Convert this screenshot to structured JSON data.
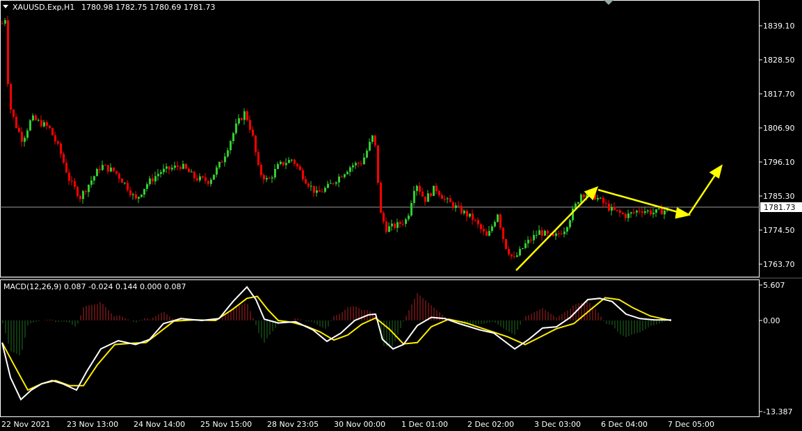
{
  "header": {
    "symbol": "XAUUSD.Exp,H1",
    "ohlc": "1780.98 1782.75 1780.69 1781.73"
  },
  "price_axis": {
    "ticks": [
      "1839.10",
      "1828.50",
      "1817.70",
      "1806.90",
      "1796.10",
      "1785.30",
      "1774.50",
      "1763.70"
    ],
    "current_price": "1781.73"
  },
  "macd_panel": {
    "label": "MACD(12,26,9) 0.087 -0.024 0.144 0.000 0.087",
    "ticks": [
      "5.607",
      "0.00",
      "-13.387"
    ]
  },
  "time_axis": {
    "labels": [
      "22 Nov 2021",
      "23 Nov 13:00",
      "24 Nov 14:00",
      "25 Nov 15:00",
      "28 Nov 23:05",
      "30 Nov 00:00",
      "1 Dec 01:00",
      "2 Dec 02:00",
      "3 Dec 03:00",
      "6 Dec 04:00",
      "7 Dec 05:00"
    ]
  },
  "colors": {
    "background": "#000000",
    "bull": "#32cd32",
    "bear": "#ff0000",
    "macd_line": "#ffffff",
    "signal_line": "#ffee00",
    "hist_pos": "#b22222",
    "hist_neg": "#1f6f1f",
    "arrow": "#ffff00",
    "grid_frame": "#ffffff"
  },
  "chart_data": {
    "type": "line",
    "price_path": {
      "x": [
        "22 Nov 2021",
        "23 Nov 13:00",
        "24 Nov 14:00",
        "25 Nov 15:00",
        "28 Nov 23:05",
        "30 Nov 00:00",
        "1 Dec 01:00",
        "2 Dec 02:00",
        "3 Dec 03:00",
        "6 Dec 04:00",
        "7 Dec 05:00"
      ],
      "close": [
        1843.5,
        1794.0,
        1788.5,
        1812.0,
        1789.0,
        1803.0,
        1788.0,
        1766.0,
        1772.5,
        1782.0,
        1781.7
      ]
    },
    "macd": {
      "x": [
        "22 Nov 2021",
        "23 Nov 13:00",
        "24 Nov 14:00",
        "25 Nov 15:00",
        "28 Nov 23:05",
        "30 Nov 00:00",
        "1 Dec 01:00",
        "2 Dec 02:00",
        "3 Dec 03:00",
        "6 Dec 04:00",
        "7 Dec 05:00"
      ],
      "series": [
        {
          "name": "MACD",
          "values": [
            -3.0,
            -7.5,
            -2.5,
            0.0,
            4.5,
            -1.5,
            0.0,
            -3.5,
            -1.0,
            3.5,
            0.087
          ]
        },
        {
          "name": "Signal",
          "values": [
            -3.5,
            -8.0,
            -3.5,
            0.0,
            3.5,
            -2.5,
            0.0,
            -3.0,
            -1.5,
            2.5,
            -0.024
          ]
        }
      ],
      "ylim": [
        -13.387,
        5.607
      ]
    },
    "ylim": [
      1760.0,
      1846.0
    ]
  }
}
